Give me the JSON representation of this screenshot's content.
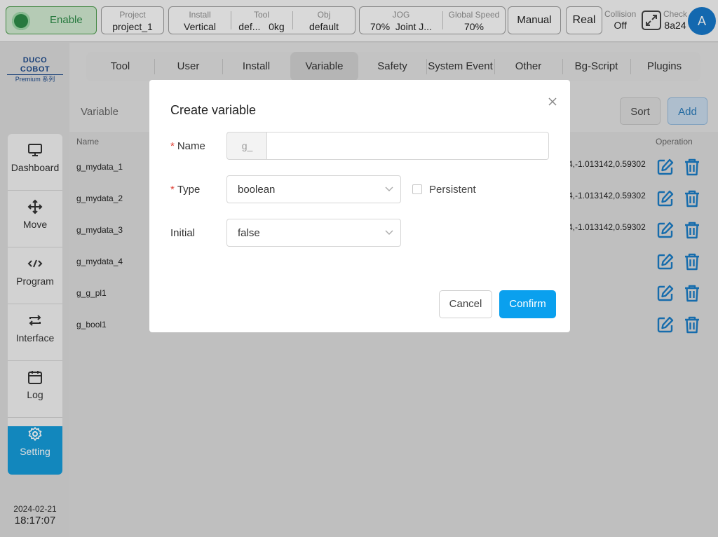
{
  "topbar": {
    "enable_label": "Enable",
    "project": {
      "label": "Project",
      "value": "project_1"
    },
    "install": {
      "label": "Install",
      "value": "Vertical"
    },
    "tool": {
      "label": "Tool",
      "value": "def...",
      "load": "0kg"
    },
    "obj": {
      "label": "Obj",
      "value": "default"
    },
    "jog": {
      "label": "JOG",
      "value": "70%",
      "mode": "Joint J..."
    },
    "global_speed": {
      "label": "Global Speed",
      "value": "70%"
    },
    "manual_label": "Manual",
    "real_label": "Real",
    "collision": {
      "label": "Collision",
      "value": "Off"
    },
    "check": {
      "label": "Check",
      "value": "8a24"
    },
    "avatar_letter": "A"
  },
  "logo": {
    "line1": "DUCO COBOT",
    "line2": "Premium 系列"
  },
  "sidebar": {
    "items": [
      {
        "label": "Dashboard",
        "icon": "monitor-icon"
      },
      {
        "label": "Move",
        "icon": "move-arrows-icon"
      },
      {
        "label": "Program",
        "icon": "code-icon"
      },
      {
        "label": "Interface",
        "icon": "swap-icon"
      },
      {
        "label": "Log",
        "icon": "calendar-icon"
      },
      {
        "label": "Setting",
        "icon": "gear-icon",
        "active": true
      }
    ]
  },
  "datetime": {
    "date": "2024-02-21",
    "time": "18:17:07"
  },
  "tabs": [
    "Tool",
    "User",
    "Install",
    "Variable",
    "Safety",
    "System Event",
    "Other",
    "Bg-Script",
    "Plugins"
  ],
  "active_tab": "Variable",
  "section": {
    "title": "Variable",
    "sort_label": "Sort",
    "add_label": "Add"
  },
  "table": {
    "headers": {
      "name": "Name",
      "operation": "Operation"
    },
    "rows": [
      {
        "name": "g_mydata_1",
        "value": "4,-1.013142,0.59302"
      },
      {
        "name": "g_mydata_2",
        "value": "4,-1.013142,0.59302"
      },
      {
        "name": "g_mydata_3",
        "value": "4,-1.013142,0.59302"
      },
      {
        "name": "g_mydata_4",
        "value": ""
      },
      {
        "name": "g_g_pl1",
        "value": ""
      },
      {
        "name": "g_bool1",
        "value": ""
      }
    ]
  },
  "modal": {
    "title": "Create variable",
    "required_mark": "*",
    "name_label": "Name",
    "name_prefix": "g_",
    "name_value": "",
    "type_label": "Type",
    "type_value": "boolean",
    "persistent_label": "Persistent",
    "persistent_checked": false,
    "initial_label": "Initial",
    "initial_value": "false",
    "cancel_label": "Cancel",
    "confirm_label": "Confirm"
  },
  "colors": {
    "accent": "#0aa0ee",
    "active_nav": "#159ad8",
    "enable_green": "#2d8a47",
    "icon_blue": "#1a7bc4",
    "required": "#e0453a"
  }
}
